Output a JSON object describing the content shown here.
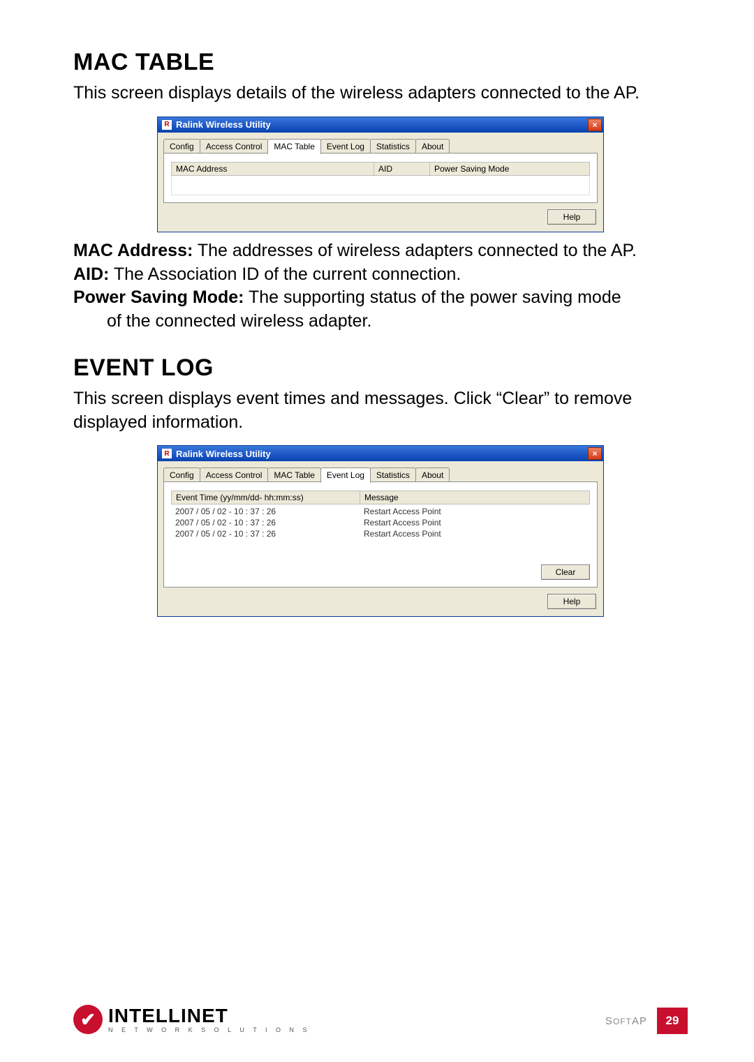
{
  "sections": {
    "mac_table": {
      "title": "MAC TABLE",
      "intro": "This screen displays details of the wireless adapters connected to the AP.",
      "defs": {
        "mac_label": "MAC Address:",
        "mac_text": " The addresses of wireless adapters connected to the AP.",
        "aid_label": "AID:",
        "aid_text": " The Association ID of the current connection.",
        "psm_label": "Power Saving Mode:",
        "psm_text_line1": " The supporting status of the power saving mode",
        "psm_text_line2": "of the connected wireless adapter."
      }
    },
    "event_log": {
      "title": "EVENT LOG",
      "intro": "This screen displays event times and messages. Click “Clear” to remove displayed information."
    }
  },
  "win1": {
    "title": "Ralink Wireless Utility",
    "tabs": [
      "Config",
      "Access Control",
      "MAC Table",
      "Event Log",
      "Statistics",
      "About"
    ],
    "active_tab": "MAC Table",
    "columns": {
      "col1": "MAC Address",
      "col2": "AID",
      "col3": "Power Saving Mode"
    },
    "help_btn": "Help"
  },
  "win2": {
    "title": "Ralink Wireless Utility",
    "tabs": [
      "Config",
      "Access Control",
      "MAC Table",
      "Event Log",
      "Statistics",
      "About"
    ],
    "active_tab": "Event Log",
    "columns": {
      "col1": "Event Time (yy/mm/dd- hh:mm:ss)",
      "col2": "Message"
    },
    "rows": [
      {
        "time": "2007 / 05 / 02 - 10 : 37 : 26",
        "msg": "Restart Access Point"
      },
      {
        "time": "2007 / 05 / 02 - 10 : 37 : 26",
        "msg": "Restart Access Point"
      },
      {
        "time": "2007 / 05 / 02 - 10 : 37 : 26",
        "msg": "Restart Access Point"
      }
    ],
    "clear_btn": "Clear",
    "help_btn": "Help"
  },
  "footer": {
    "brand": "INTELLINET",
    "tag": "N E T W O R K  S O L U T I O N S",
    "softap": "SOFTAP",
    "page": "29"
  }
}
